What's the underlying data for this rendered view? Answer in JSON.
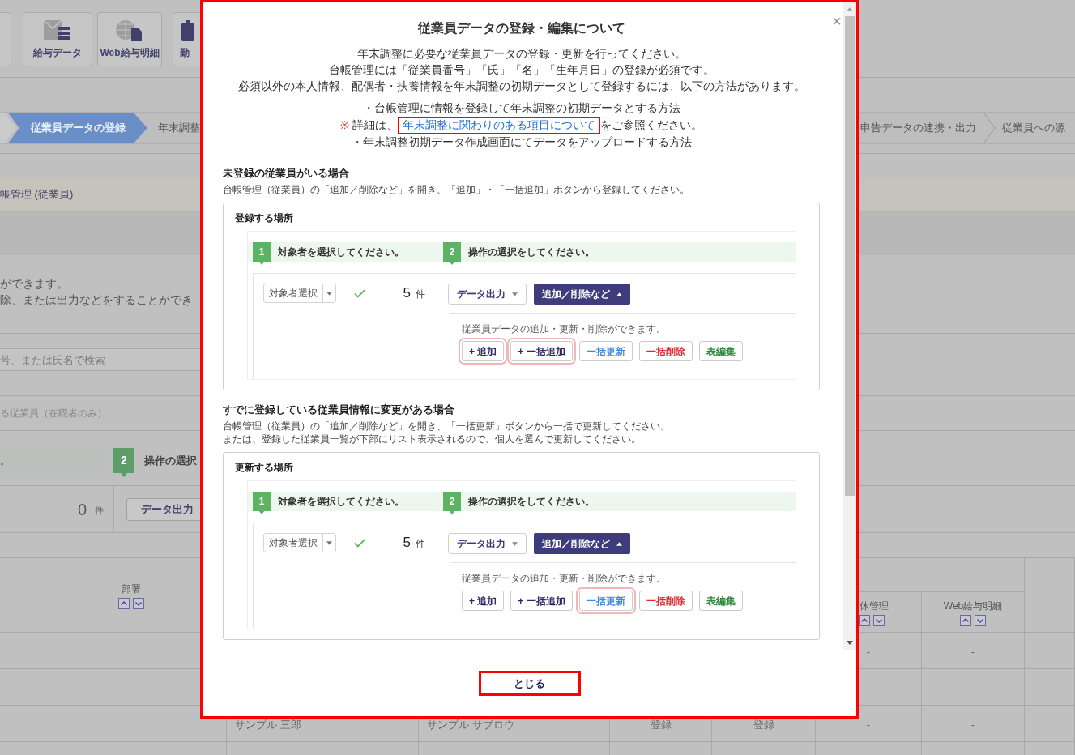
{
  "background": {
    "toolbar": [
      {
        "label": "給与データ",
        "kind": "payroll"
      },
      {
        "label": "Web給与明細",
        "kind": "web"
      },
      {
        "label": "勤",
        "kind": "attendance"
      }
    ],
    "steps_left": [
      {
        "label": "従業員データの登録",
        "selected": true
      },
      {
        "label": "年末調整",
        "selected": false
      }
    ],
    "steps_right": [
      {
        "label": "申告データの連携・出力",
        "selected": false
      },
      {
        "label": "従業員への源",
        "selected": false
      }
    ],
    "section_title": "帳管理 (従業員)",
    "description": [
      "ができます。",
      "除、または出力などをすることができ"
    ],
    "search": {
      "placeholder": "号、または氏名で検索"
    },
    "filter": "る従業員（在職者のみ）",
    "step_banner": {
      "hint": "。",
      "number": "2",
      "label": "操作の選択"
    },
    "count": {
      "value": "0",
      "unit": "件"
    },
    "export_button": "データ出力",
    "table": {
      "columns": [
        {
          "label": "部署"
        },
        {
          "label": "休管理"
        },
        {
          "label": "Web給与明細"
        }
      ],
      "rows": [
        {
          "leave": "-",
          "web_payslip": "-"
        },
        {
          "leave": "-",
          "web_payslip": "-"
        },
        {
          "name": "サンプル 三郎",
          "kana": "サンプル サブロウ",
          "column_5": "登録",
          "column_6": "登録",
          "leave": "-",
          "web_payslip": "-"
        }
      ]
    }
  },
  "dialog": {
    "title": "従業員データの登録・編集について",
    "close": "×",
    "paragraphs": [
      "年末調整に必要な従業員データの登録・更新を行ってください。",
      "台帳管理には「従業員番号」「氏」「名」「生年月日」の登録が必須です。",
      "必須以外の本人情報、配偶者・扶養情報を年末調整の初期データとして登録するには、以下の方法があります。"
    ],
    "methods": [
      {
        "kind": "bullet",
        "text": "・台帳管理に情報を登録して年末調整の初期データとする方法"
      },
      {
        "kind": "note",
        "mark": "※",
        "before": "詳細は、",
        "link": "年末調整に関わりのある項目について",
        "after": "をご参照ください。"
      },
      {
        "kind": "bullet",
        "text": "・年末調整初期データ作成画面にてデータをアップロードする方法"
      }
    ],
    "sections": [
      {
        "heading": "未登録の従業員がいる場合",
        "description": [
          "台帳管理（従業員）の「追加／削除など」を開き、「追加」・「一括追加」ボタンから登録してください。"
        ],
        "card": {
          "label": "登録する場所",
          "screenshot": {
            "steps": [
              {
                "number": "1",
                "label": "対象者を選択してください。"
              },
              {
                "number": "2",
                "label": "操作の選択をしてください。"
              }
            ],
            "select": "対象者選択",
            "count": "5",
            "unit": "件",
            "export_button": "データ出力",
            "actions_button": "追加／削除など",
            "panel_text": "従業員データの追加・更新・削除ができます。",
            "buttons": [
              {
                "label": "+ 追加",
                "kind": "add",
                "highlighted": true
              },
              {
                "label": "+ 一括追加",
                "kind": "add",
                "highlighted": true
              },
              {
                "label": "一括更新",
                "kind": "update",
                "highlighted": false
              },
              {
                "label": "一括削除",
                "kind": "delete",
                "highlighted": false
              },
              {
                "label": "表編集",
                "kind": "edit",
                "highlighted": false
              }
            ]
          }
        }
      },
      {
        "heading": "すでに登録している従業員情報に変更がある場合",
        "description": [
          "台帳管理（従業員）の「追加／削除など」を開き、「一括更新」ボタンから一括で更新してください。",
          "または、登録した従業員一覧が下部にリスト表示されるので、個人を選んで更新してください。"
        ],
        "card": {
          "label": "更新する場所",
          "screenshot": {
            "steps": [
              {
                "number": "1",
                "label": "対象者を選択してください。"
              },
              {
                "number": "2",
                "label": "操作の選択をしてください。"
              }
            ],
            "select": "対象者選択",
            "count": "5",
            "unit": "件",
            "export_button": "データ出力",
            "actions_button": "追加／削除など",
            "panel_text": "従業員データの追加・更新・削除ができます。",
            "buttons": [
              {
                "label": "+ 追加",
                "kind": "add",
                "highlighted": false
              },
              {
                "label": "+ 一括追加",
                "kind": "add",
                "highlighted": false
              },
              {
                "label": "一括更新",
                "kind": "update",
                "highlighted": true
              },
              {
                "label": "一括削除",
                "kind": "delete",
                "highlighted": false
              },
              {
                "label": "表編集",
                "kind": "edit",
                "highlighted": false
              }
            ]
          }
        }
      }
    ],
    "close_button": "とじる"
  }
}
